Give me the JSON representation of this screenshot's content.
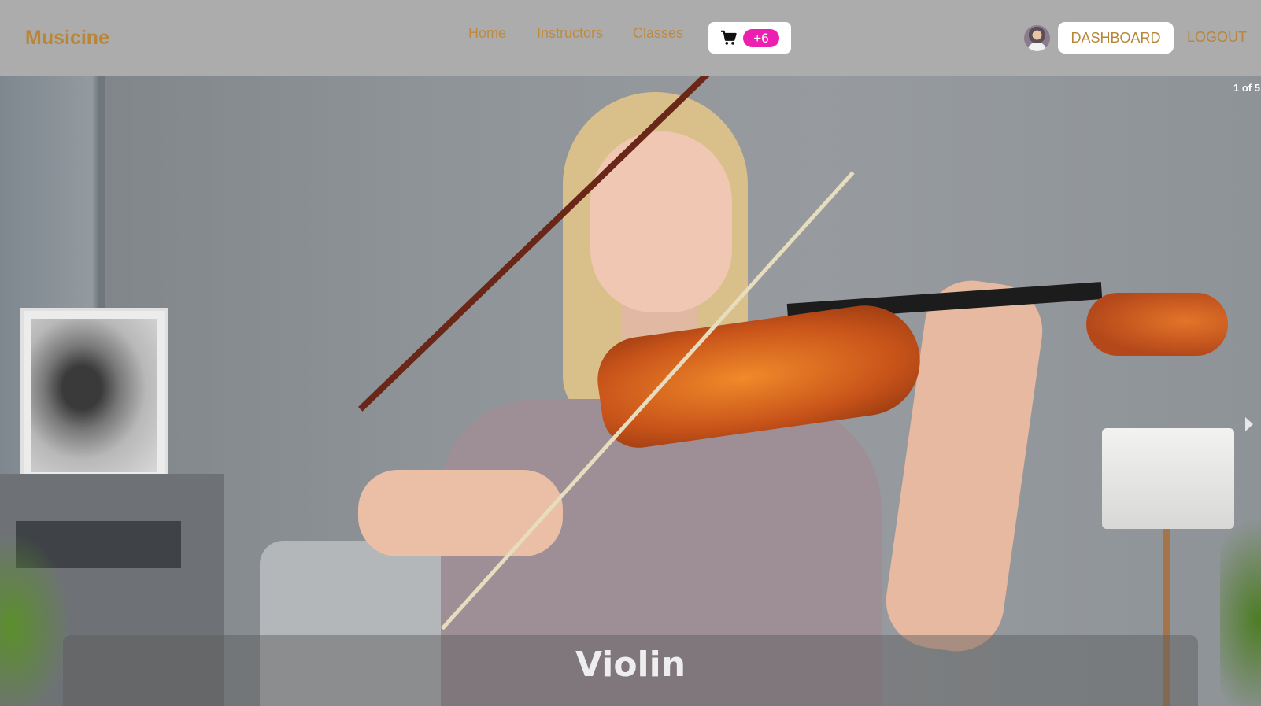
{
  "navbar": {
    "brand": "Musicine",
    "links": [
      {
        "label": "Home"
      },
      {
        "label": "Instructors"
      },
      {
        "label": "Classes"
      }
    ],
    "cart": {
      "icon": "shopping-cart-icon",
      "badge": "+6",
      "badge_color": "#ed1fb1"
    },
    "avatar": "user-avatar",
    "dashboard_label": "DASHBOARD",
    "logout_label": "LOGOUT",
    "background": "#acacac",
    "accent": "#b98539"
  },
  "carousel": {
    "counter": "1 of 5",
    "caption": "Violin",
    "next_icon": "chevron-right-icon"
  }
}
